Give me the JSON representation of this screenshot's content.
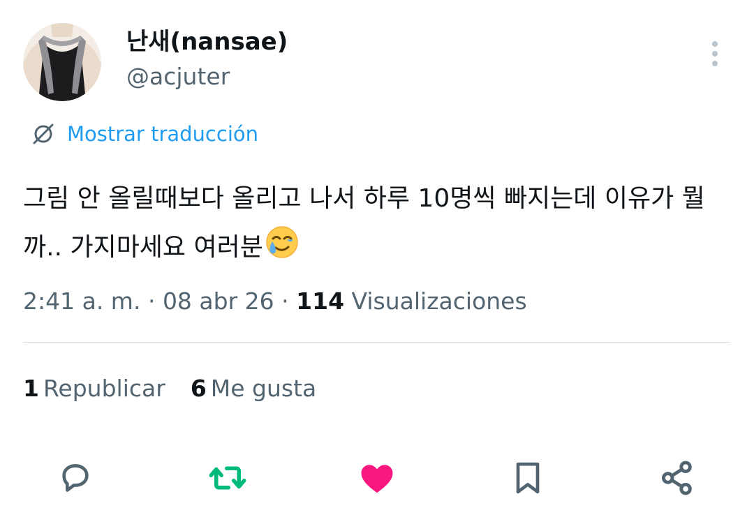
{
  "author": {
    "display_name": "난새(nansae)",
    "handle": "@acjuter"
  },
  "translate": {
    "label": "Mostrar traducción"
  },
  "tweet": {
    "text": "그림 안 올릴때보다 올리고 나서 하루 10명씩 빠지는데 이유가 뭘까.. 가지마세요 여러분",
    "emoji": "face-holding-back-tears"
  },
  "meta": {
    "time": "2:41 a. m.",
    "date": "08 abr 26",
    "views_count": "114",
    "views_label": "Visualizaciones",
    "separator": "·"
  },
  "stats": {
    "reposts_count": "1",
    "reposts_label": "Republicar",
    "likes_count": "6",
    "likes_label": "Me gusta"
  },
  "actions": {
    "reply_icon": "speech-bubble-icon",
    "retweet_icon": "retweet-icon",
    "like_icon": "heart-icon",
    "bookmark_icon": "bookmark-icon",
    "share_icon": "share-icon"
  },
  "colors": {
    "link": "#1d9bf0",
    "secondary_text": "#536471",
    "retweet_active": "#00ba7c",
    "like_active": "#f91880",
    "icon_default": "#536471"
  }
}
